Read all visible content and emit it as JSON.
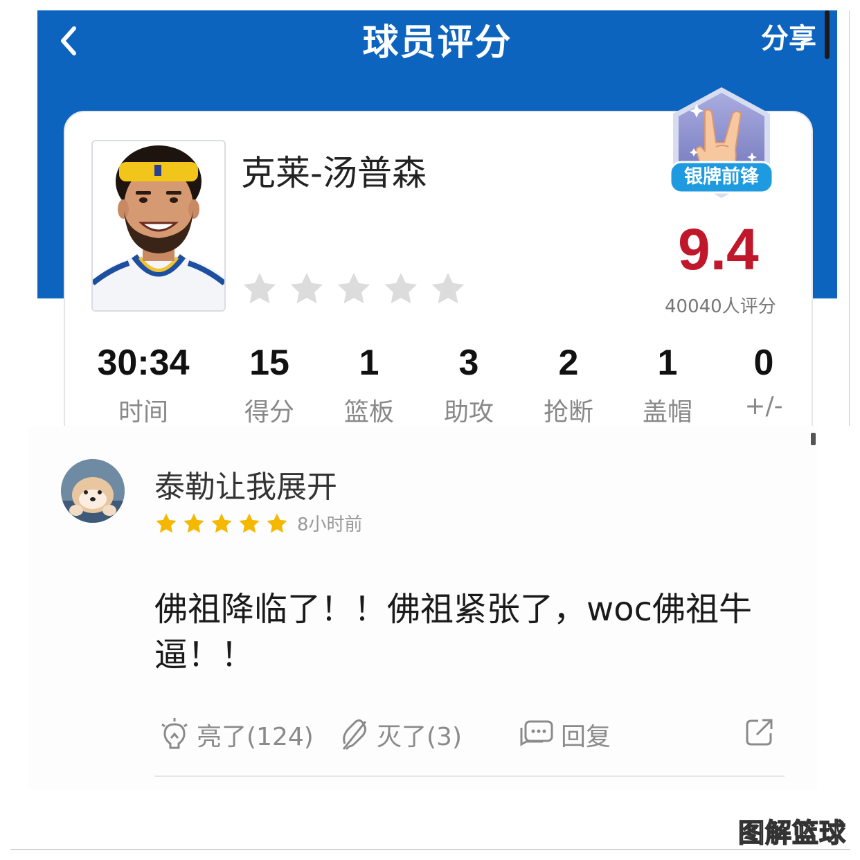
{
  "header": {
    "title": "球员评分",
    "share_label": "分享"
  },
  "player": {
    "name": "克莱-汤普森",
    "badge_label": "银牌前锋",
    "score": "9.4",
    "rating_count": "40040人评分",
    "stats": [
      {
        "value": "30:34",
        "label": "时间"
      },
      {
        "value": "15",
        "label": "得分"
      },
      {
        "value": "1",
        "label": "篮板"
      },
      {
        "value": "3",
        "label": "助攻"
      },
      {
        "value": "2",
        "label": "抢断"
      },
      {
        "value": "1",
        "label": "盖帽"
      },
      {
        "value": "0",
        "label": "+/-"
      }
    ],
    "user_star_rating": 0
  },
  "comment": {
    "username": "泰勒让我展开",
    "stars": 5,
    "time_ago": "8小时前",
    "text": "佛祖降临了！！佛祖紧张了，woc佛祖牛逼！！",
    "like_label": "亮了(124)",
    "dislike_label": "灭了(3)",
    "reply_label": "回复"
  },
  "watermark": "图解篮球",
  "colors": {
    "header_blue": "#0d64be",
    "score_red": "#c0182b",
    "star_yellow": "#f5b800",
    "badge_purple": "#7b7fc4",
    "badge_ribbon": "#1e9be0"
  }
}
